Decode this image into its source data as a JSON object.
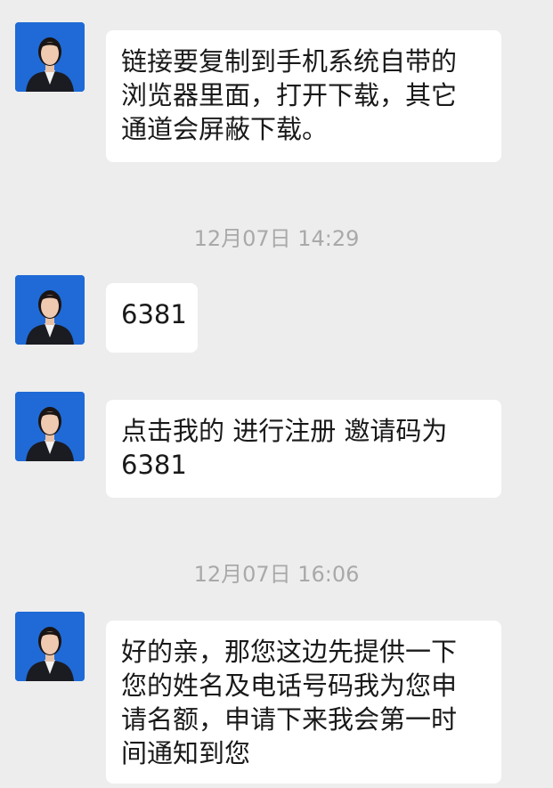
{
  "colors": {
    "background": "#ededed",
    "bubble": "#ffffff",
    "text": "#191919",
    "timestamp": "#a9a9a9",
    "avatar_bg": "#1f6ad6"
  },
  "avatar_icon": "person-photo-icon",
  "messages": [
    {
      "lines": [
        "链接要复制到手机系统自带的",
        "浏览器里面，打开下载，其它",
        "通道会屏蔽下载。"
      ]
    },
    {
      "lines": [
        "6381"
      ]
    },
    {
      "lines": [
        "点击我的 进行注册 邀请码为",
        "6381"
      ]
    },
    {
      "lines": [
        "好的亲，那您这边先提供一下",
        "您的姓名及电话号码我为您申",
        "请名额，申请下来我会第一时",
        "间通知到您"
      ]
    }
  ],
  "timestamps": [
    "12月07日 14:29",
    "12月07日 16:06"
  ]
}
